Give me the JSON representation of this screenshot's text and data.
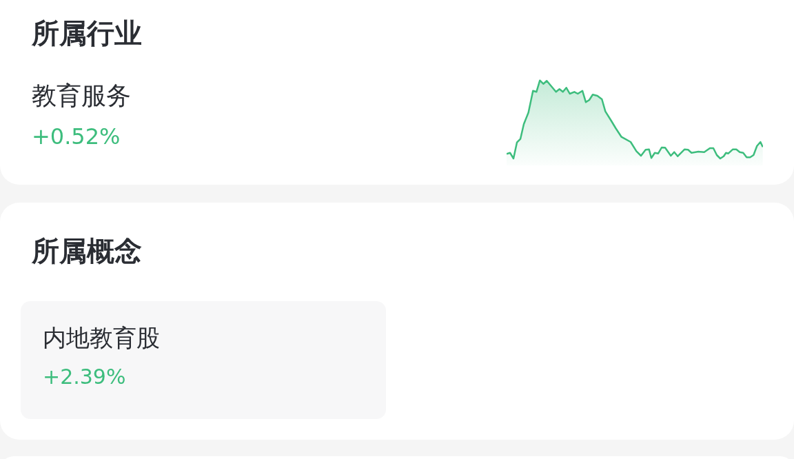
{
  "industry": {
    "title": "所属行业",
    "name": "教育服务",
    "change": "+0.52%"
  },
  "concepts": {
    "title": "所属概念",
    "items": [
      {
        "name": "内地教育股",
        "change": "+2.39%"
      }
    ]
  }
}
